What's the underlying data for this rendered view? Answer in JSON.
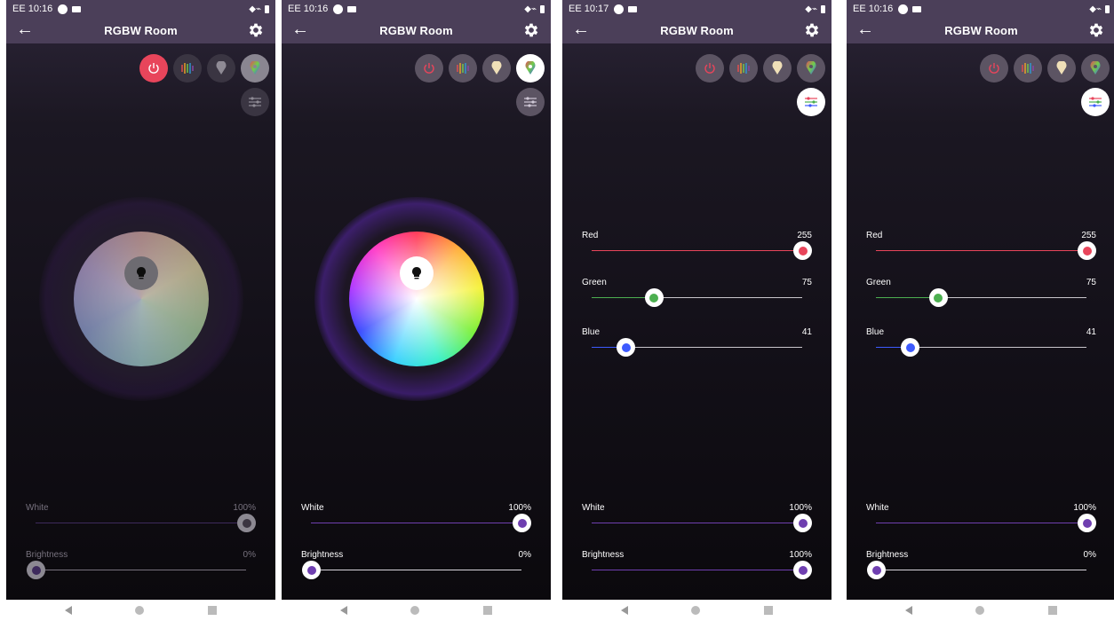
{
  "app": {
    "title": "RGBW Room",
    "status_right": "◆ˑ▐"
  },
  "colors": {
    "appbar": "#4b3f59",
    "power_on": "#e8455b",
    "accent_purple": "#6f3fb0",
    "red_track": "#e8455b",
    "green_track": "#4caf50",
    "blue_track": "#3d5afe"
  },
  "screens": [
    {
      "time": "EE 10:16",
      "state": "dimmed",
      "white": {
        "label": "White",
        "value": "100%",
        "level": 1.0
      },
      "brightness": {
        "label": "Brightness",
        "value": "0%",
        "level": 0.0
      }
    },
    {
      "time": "EE 10:16",
      "state": "wheel",
      "white": {
        "label": "White",
        "value": "100%",
        "level": 1.0
      },
      "brightness": {
        "label": "Brightness",
        "value": "0%",
        "level": 0.0
      }
    },
    {
      "time": "EE 10:17",
      "state": "sliders",
      "red": {
        "label": "Red",
        "value": "255",
        "level": 1.0
      },
      "green": {
        "label": "Green",
        "value": "75",
        "level": 0.294
      },
      "blue": {
        "label": "Blue",
        "value": "41",
        "level": 0.161
      },
      "white": {
        "label": "White",
        "value": "100%",
        "level": 1.0
      },
      "brightness": {
        "label": "Brightness",
        "value": "100%",
        "level": 1.0
      }
    },
    {
      "time": "EE 10:16",
      "state": "sliders",
      "red": {
        "label": "Red",
        "value": "255",
        "level": 1.0
      },
      "green": {
        "label": "Green",
        "value": "75",
        "level": 0.294
      },
      "blue": {
        "label": "Blue",
        "value": "41",
        "level": 0.161
      },
      "white": {
        "label": "White",
        "value": "100%",
        "level": 1.0
      },
      "brightness": {
        "label": "Brightness",
        "value": "0%",
        "level": 0.0
      }
    }
  ],
  "icons": {
    "back": "back-arrow-icon",
    "settings": "gear-icon",
    "power": "power-icon",
    "music": "music-spectrum-icon",
    "scene": "scene-drop-icon",
    "color": "color-drop-icon",
    "filter": "filter-sliders-icon",
    "bulb": "bulb-icon"
  }
}
